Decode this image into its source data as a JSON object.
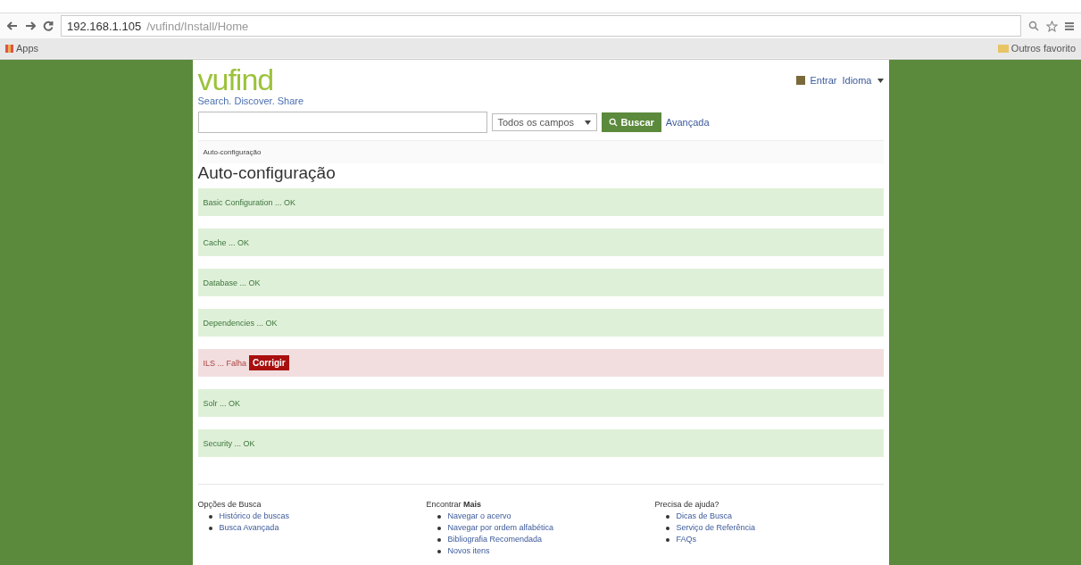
{
  "browser": {
    "url_host": "192.168.1.105",
    "url_path": "/vufind/Install/Home",
    "bookmarks": [
      {
        "label": "Apps"
      }
    ],
    "other_bookmarks": "Outros favorito"
  },
  "header": {
    "logo": "vufind",
    "tagline": "Search. Discover. Share",
    "login": "Entrar",
    "language": "Idioma"
  },
  "search": {
    "scope": "Todos os campos",
    "button": "Buscar",
    "advanced": "Avançada"
  },
  "breadcrumb": "Auto-configuração",
  "title": "Auto-configuração",
  "checks": [
    {
      "label": "Basic Configuration ... OK",
      "failed": false
    },
    {
      "label": "Cache ... OK",
      "failed": false
    },
    {
      "label": "Database ... OK",
      "failed": false
    },
    {
      "label": "Dependencies ... OK",
      "failed": false
    },
    {
      "label": "ILS ... Falha",
      "failed": true,
      "action": "Corrigir"
    },
    {
      "label": "Solr ... OK",
      "failed": false
    },
    {
      "label": "Security ... OK",
      "failed": false
    }
  ],
  "footer": [
    {
      "heading": "Opções de Busca",
      "links": [
        "Histórico de buscas",
        "Busca Avançada"
      ]
    },
    {
      "heading": "Encontrar **Mais**",
      "links": [
        "Navegar o acervo",
        "Navegar por ordem alfabética",
        "Bibliografia Recomendada",
        "Novos itens"
      ]
    },
    {
      "heading": "Precisa de ajuda?",
      "links": [
        "Dicas de Busca",
        "Serviço de Referência",
        "FAQs"
      ]
    }
  ]
}
